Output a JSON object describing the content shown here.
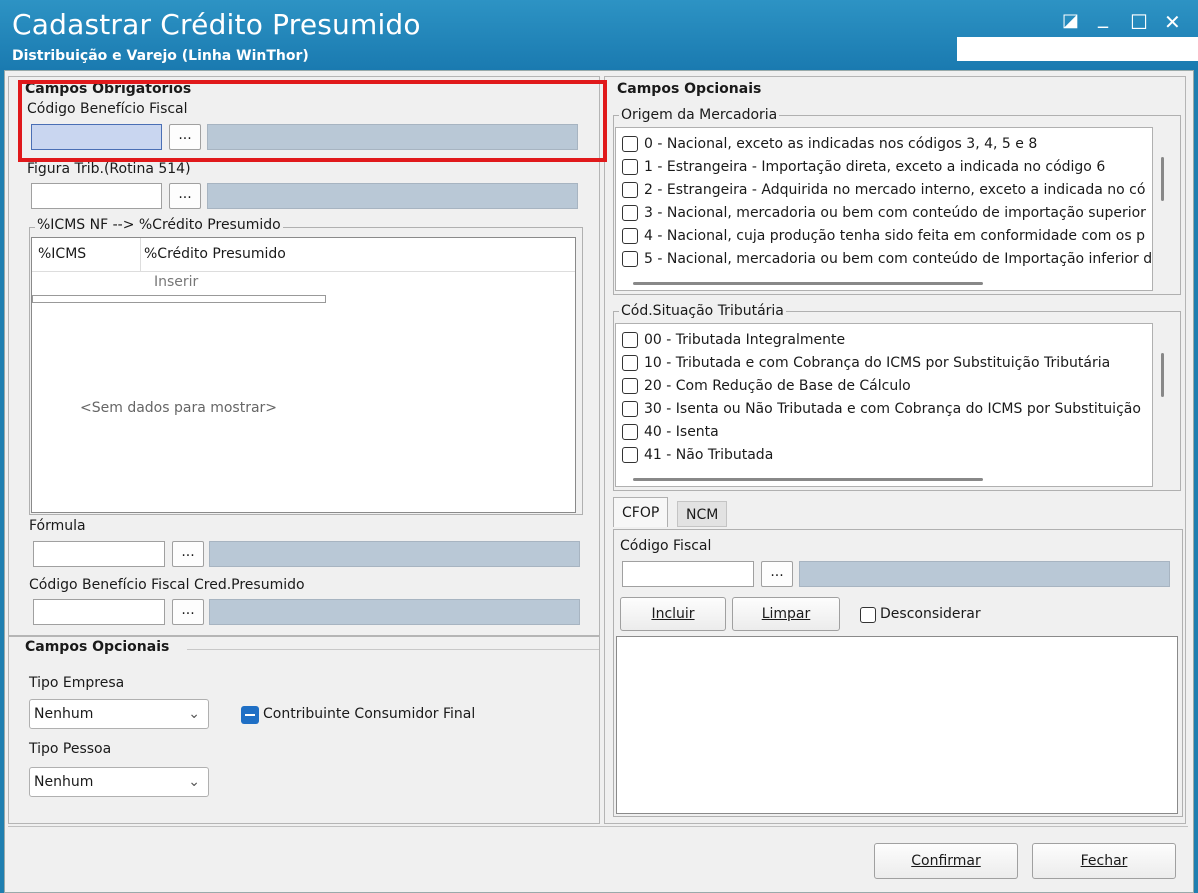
{
  "window": {
    "title": "Cadastrar Crédito Presumido",
    "subtitle": "Distribuição e Varejo (Linha WinThor)",
    "controls": {
      "restore": "◪",
      "minimize": "_",
      "maximize": "☐",
      "close": "✕"
    }
  },
  "required": {
    "title": "Campos Obrigatórios",
    "codigo_beneficio_label": "Código Benefício Fiscal",
    "figura_trib_label": "Figura Trib.(Rotina 514)",
    "icms_group_title": "%ICMS NF --> %Crédito Presumido",
    "grid": {
      "columns": [
        "%ICMS",
        "%Crédito Presumido"
      ],
      "insert_text": "Inserir",
      "empty_text": "<Sem dados para mostrar>"
    },
    "formula_label": "Fórmula",
    "codigo_beneficio_cred_label": "Código Benefício Fiscal Cred.Presumido",
    "ellipsis": "..."
  },
  "optional_left": {
    "title": "Campos Opcionais",
    "tipo_empresa_label": "Tipo Empresa",
    "tipo_empresa_value": "Nenhum",
    "contribuinte_label": "Contribuinte Consumidor Final",
    "tipo_pessoa_label": "Tipo Pessoa",
    "tipo_pessoa_value": "Nenhum"
  },
  "optional_right": {
    "title": "Campos Opcionais",
    "origem_title": "Origem da Mercadoria",
    "origem_items": [
      "0 - Nacional, exceto as indicadas nos códigos 3, 4, 5 e 8",
      "1 - Estrangeira - Importação direta, exceto a indicada no código 6",
      "2 - Estrangeira - Adquirida no mercado interno, exceto a indicada no có",
      "3 - Nacional, mercadoria ou bem com conteúdo de importação superior",
      "4 - Nacional, cuja produção tenha sido feita em conformidade com os p",
      "5 - Nacional, mercadoria ou bem com conteúdo de Importação inferior d"
    ],
    "cst_title": "Cód.Situação Tributária",
    "cst_items": [
      "00 - Tributada Integralmente",
      "10 - Tributada e com Cobrança do ICMS por Substituição Tributária",
      "20 - Com Redução de Base de Cálculo",
      "30 - Isenta ou Não Tributada e com Cobrança do ICMS por Substituição",
      "40 - Isenta",
      "41 - Não Tributada"
    ],
    "tabs": [
      "CFOP",
      "NCM"
    ],
    "codigo_fiscal_label": "Código Fiscal",
    "incluir": "Incluir",
    "limpar": "Limpar",
    "desconsiderar": "Desconsiderar"
  },
  "footer": {
    "confirmar": "Confirmar",
    "fechar": "Fechar"
  }
}
